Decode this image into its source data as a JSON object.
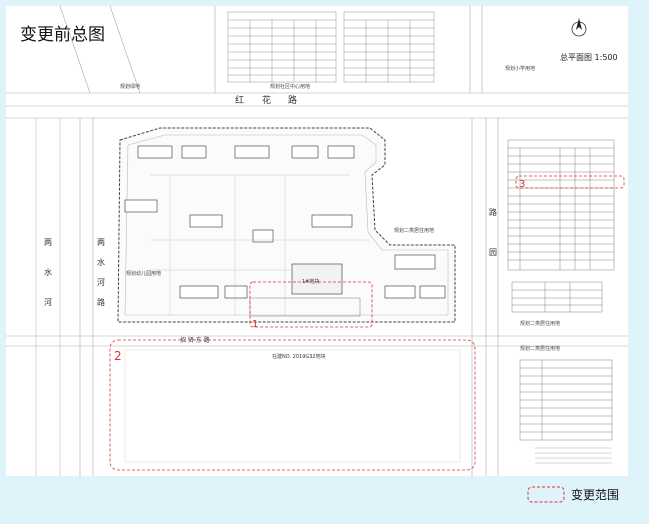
{
  "page": {
    "title": "变更前总图",
    "scale_note": "总平面图 1:500"
  },
  "legend": {
    "label": "变更范围",
    "color": "#e03030"
  },
  "map_labels": {
    "north_road_west": "规划绿地",
    "north_road_mid": "规划社区中心用地",
    "north_road_east": "规划小学用地",
    "road_north_1": "红",
    "road_north_2": "花",
    "road_north_3": "路",
    "road_west_1": "两",
    "road_west_2": "水",
    "road_west_3": "河",
    "road_west_4": "路",
    "river_1": "两",
    "river_2": "水",
    "river_3": "河",
    "kindergarten": "规划幼儿园用地",
    "residential_e": "规划二类居住用地",
    "residential_se": "规划二类居住用地",
    "residential_se2": "规划二类居住用地",
    "road_east_1": "路",
    "road_east_2": "园",
    "south_road": "招 贤 东 路",
    "south_block": "在建NO. 2019G32地块",
    "inner_box": "1#地块",
    "marker_1": "1",
    "marker_2": "2",
    "marker_3": "3"
  }
}
